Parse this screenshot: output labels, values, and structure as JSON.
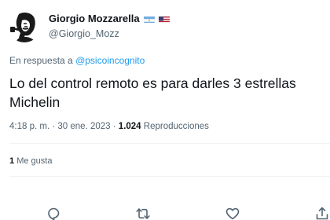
{
  "author": {
    "name": "Giorgio Mozzarella",
    "handle": "@Giorgio_Mozz",
    "flags": [
      "flag-argentina-icon",
      "flag-usa-icon"
    ],
    "avatar_icon": "man-with-pipe-avatar-icon"
  },
  "reply": {
    "prefix": "En respuesta a",
    "mention": "@psicoincognito"
  },
  "tweet": {
    "text": "Lo del control remoto es para darles 3 estrellas Michelin",
    "time": "4:18 p. m.",
    "separator": "·",
    "date": "30 ene. 2023",
    "views_count": "1.024",
    "views_label": "Reproducciones"
  },
  "likes": {
    "count": "1",
    "label": "Me gusta"
  },
  "actions": [
    "reply-icon",
    "retweet-icon",
    "like-icon",
    "share-icon"
  ],
  "colors": {
    "accent": "#1d9bf0",
    "secondary_text": "#536471",
    "primary_text": "#0f1419"
  }
}
